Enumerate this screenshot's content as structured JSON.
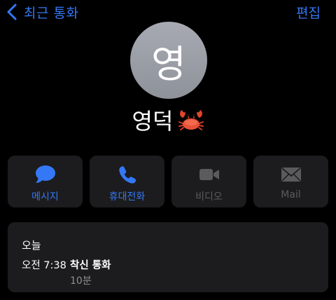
{
  "nav": {
    "back_label": "최근 통화",
    "edit_label": "편집"
  },
  "contact": {
    "avatar_initial": "영",
    "name": "영덕",
    "name_emoji": "crab-icon"
  },
  "actions": [
    {
      "label": "메시지",
      "icon": "message-icon",
      "enabled": true
    },
    {
      "label": "휴대전화",
      "icon": "phone-icon",
      "enabled": true
    },
    {
      "label": "비디오",
      "icon": "video-icon",
      "enabled": false
    },
    {
      "label": "Mail",
      "icon": "mail-icon",
      "enabled": false
    }
  ],
  "history": {
    "date": "오늘",
    "entries": [
      {
        "time": "오전 7:38",
        "type": "착신 통화",
        "duration": "10분"
      }
    ]
  },
  "colors": {
    "accent": "#3478f6",
    "background": "#000000",
    "card": "#1c1c1e",
    "disabled": "#5b5b5e",
    "avatar": "#9a9da4"
  }
}
